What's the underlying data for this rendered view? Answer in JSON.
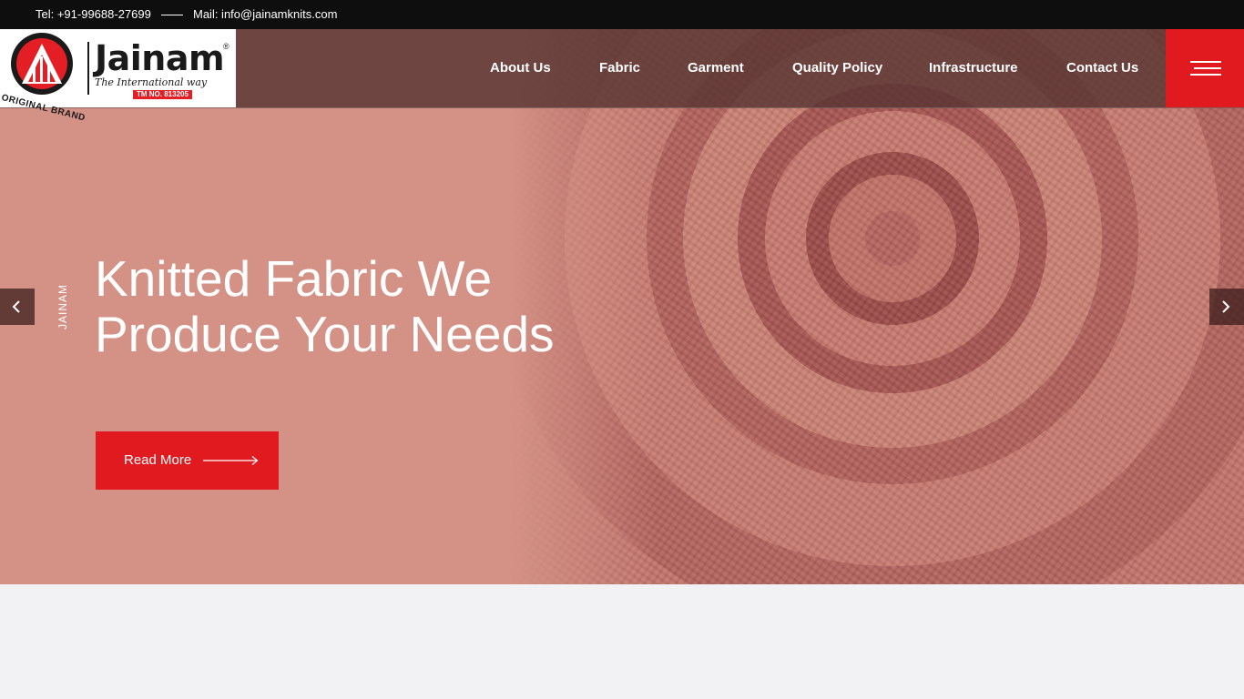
{
  "topbar": {
    "tel": "Tel: +91-99688-27699",
    "mail": "Mail: info@jainamknits.com"
  },
  "logo": {
    "brand": "Jainam",
    "reg_mark": "®",
    "tagline": "The International way",
    "trademark": "TM NO. 813205",
    "arc_text": "ORIGINAL BRAND"
  },
  "nav": {
    "items": [
      {
        "label": "About Us"
      },
      {
        "label": "Fabric"
      },
      {
        "label": "Garment"
      },
      {
        "label": "Quality Policy"
      },
      {
        "label": "Infrastructure"
      },
      {
        "label": "Contact Us"
      }
    ]
  },
  "hero": {
    "vertical_label": "JAINAM",
    "headline_line1": "Knitted Fabric We",
    "headline_line2": "Produce Your Needs",
    "button_label": "Read More"
  },
  "colors": {
    "accent": "#e01a1f",
    "topbar": "#0e0e0e",
    "hero_bg": "#d49185",
    "lower_bg": "#f2f2f4"
  },
  "icons": {
    "menu": "hamburger-icon",
    "prev": "chevron-left-icon",
    "next": "chevron-right-icon",
    "button_arrow": "long-arrow-right-icon"
  }
}
